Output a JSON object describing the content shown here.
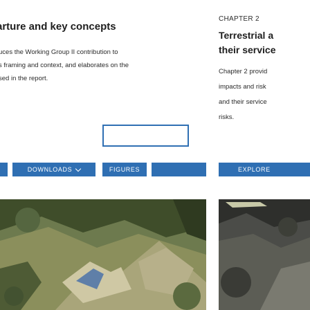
{
  "left_card": {
    "title": "arture and key concepts",
    "description_lines": [
      "uces the Working Group II contribution to",
      "s framing and context, and elaborates on the",
      "sed in the report."
    ],
    "buttons": {
      "partial_label": "",
      "downloads_label": "DOWNLOADS",
      "figures_label": "FIGURES"
    },
    "accent_color": "#2f6fb3"
  },
  "right_card": {
    "chapter": "CHAPTER 2",
    "title_lines": [
      "Terrestrial a",
      "their service"
    ],
    "description_lines": [
      "Chapter 2 provid",
      "impacts and risk",
      "and their service",
      "risks."
    ],
    "button_label": "EXPLORE"
  }
}
